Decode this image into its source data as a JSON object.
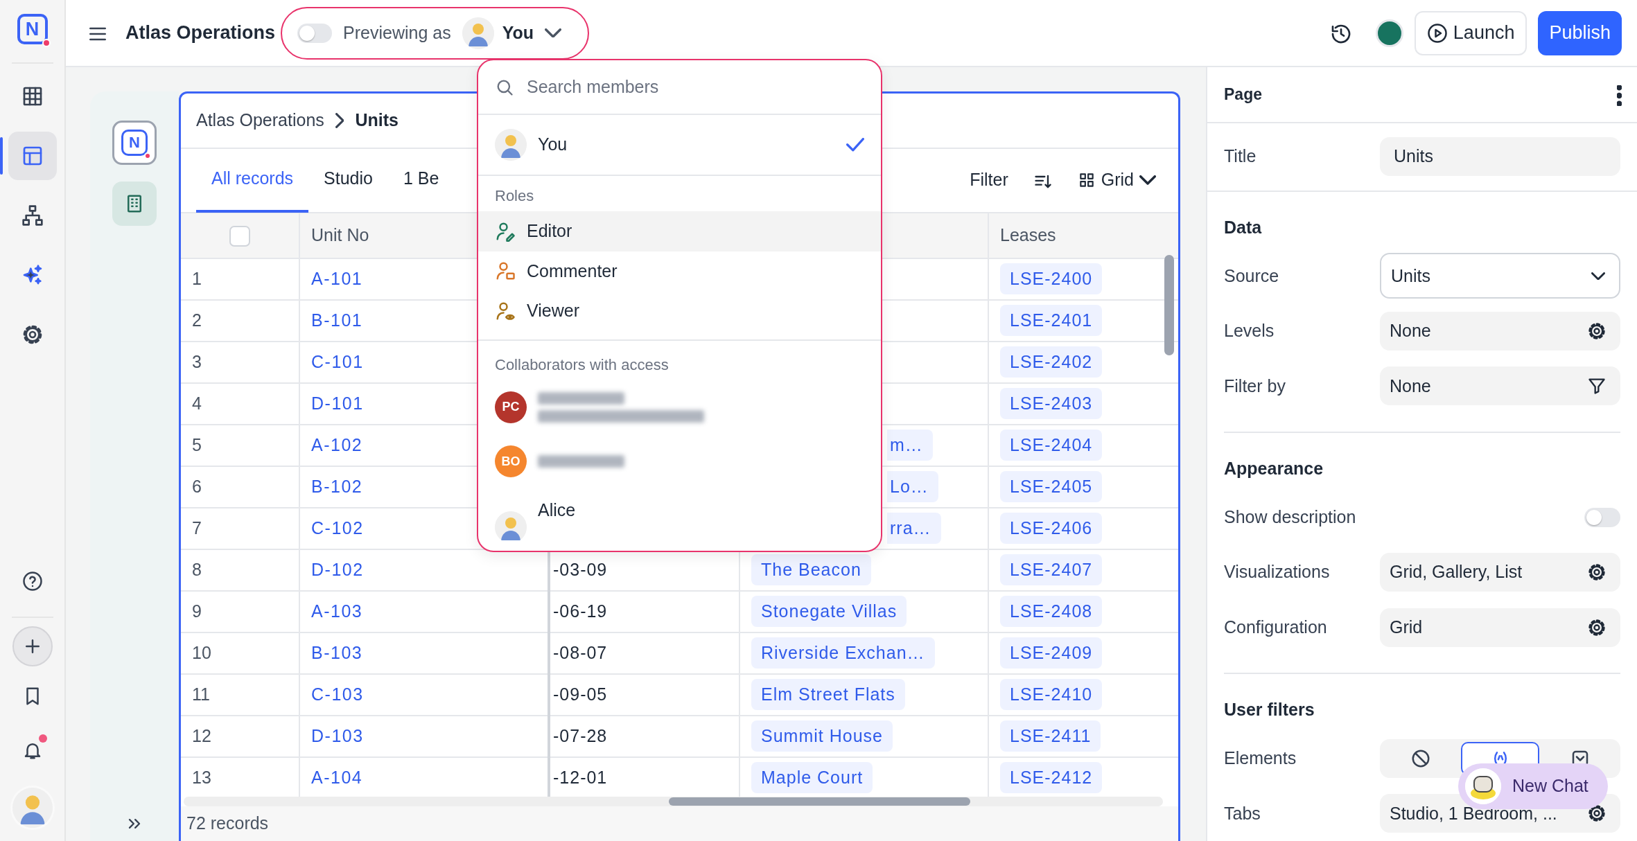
{
  "rail": {
    "logo_letter": "N",
    "items": [
      {
        "selected": false
      },
      {
        "selected": true
      },
      {
        "selected": false
      },
      {
        "selected": false
      },
      {
        "selected": false
      }
    ],
    "bottom_items": [
      {
        "notification": false
      },
      {
        "notification": false
      },
      {
        "notification": false
      },
      {
        "notification": true
      }
    ]
  },
  "topbar": {
    "title": "Atlas Operations",
    "preview": {
      "on": false,
      "label": "Previewing as",
      "user": "You"
    },
    "launch": "Launch",
    "publish": "Publish"
  },
  "members_menu": {
    "placeholder": "Search members",
    "you": {
      "name": "You",
      "selected": true
    },
    "roles_heading": "Roles",
    "roles": [
      {
        "name": "Editor",
        "color": "#1f7a5c",
        "hovered": true,
        "kind": "edit"
      },
      {
        "name": "Commenter",
        "color": "#d9772b",
        "hovered": false,
        "kind": "comment"
      },
      {
        "name": "Viewer",
        "color": "#a8741a",
        "hovered": false,
        "kind": "view"
      }
    ],
    "collaborators_heading": "Collaborators with access",
    "collaborators": [
      {
        "kind": "initials_email",
        "initials": "PC",
        "color": "#b4352c"
      },
      {
        "kind": "initials",
        "initials": "BO",
        "color": "#f5862e"
      },
      {
        "kind": "person",
        "name": "Alice"
      }
    ]
  },
  "sub_sidebar": {
    "logo_letter": "N"
  },
  "breadcrumb": [
    "Atlas Operations",
    "Units"
  ],
  "tabs": [
    {
      "label": "All records",
      "selected": true
    },
    {
      "label": "Studio",
      "selected": false
    },
    {
      "label": "1 Be",
      "selected": false
    }
  ],
  "view_controls": {
    "filter": "Filter",
    "view": "Grid"
  },
  "table": {
    "select_all": {
      "checked": false
    },
    "columns": {
      "column_2": "Unit No",
      "column_5": "Leases"
    },
    "rows": [
      {
        "number": "1",
        "unit": "A-101",
        "lease": "LSE-2400"
      },
      {
        "number": "2",
        "unit": "B-101",
        "lease": "LSE-2401"
      },
      {
        "number": "3",
        "unit": "C-101",
        "lease": "LSE-2402"
      },
      {
        "number": "4",
        "unit": "D-101",
        "lease": "LSE-2403"
      },
      {
        "number": "5",
        "unit": "A-102",
        "property": "m…",
        "covered": true,
        "lease": "LSE-2404"
      },
      {
        "number": "6",
        "unit": "B-102",
        "property": "Lo…",
        "covered": true,
        "lease": "LSE-2405"
      },
      {
        "number": "7",
        "unit": "C-102",
        "property": "rra…",
        "covered": true,
        "lease": "LSE-2406"
      },
      {
        "number": "8",
        "unit": "D-102",
        "date": "-03-09",
        "property": "The Beacon",
        "lease": "LSE-2407"
      },
      {
        "number": "9",
        "unit": "A-103",
        "date": "-06-19",
        "property": "Stonegate Villas",
        "lease": "LSE-2408"
      },
      {
        "number": "10",
        "unit": "B-103",
        "date": "-08-07",
        "property": "Riverside Exchan…",
        "lease": "LSE-2409"
      },
      {
        "number": "11",
        "unit": "C-103",
        "date": "-09-05",
        "property": "Elm Street Flats",
        "lease": "LSE-2410"
      },
      {
        "number": "12",
        "unit": "D-103",
        "date": "-07-28",
        "property": "Summit House",
        "lease": "LSE-2411"
      },
      {
        "number": "13",
        "unit": "A-104",
        "date": "-12-01",
        "property": "Maple Court",
        "lease": "LSE-2412"
      }
    ],
    "footer": "72 records"
  },
  "panel": {
    "title": "Page",
    "title_field": {
      "label": "Title",
      "value": "Units"
    },
    "sections": [
      {
        "heading": "Data",
        "fields": [
          {
            "label": "Source",
            "value": "Units",
            "kind": "select"
          },
          {
            "label": "Levels",
            "value": "None",
            "kind": "gear"
          },
          {
            "label": "Filter by",
            "value": "None",
            "kind": "filter"
          }
        ]
      },
      {
        "heading": "Appearance",
        "fields": [
          {
            "label": "Show description",
            "kind": "toggle",
            "on": false
          },
          {
            "label": "Visualizations",
            "value": "Grid, Gallery, List",
            "kind": "gear"
          },
          {
            "label": "Configuration",
            "value": "Grid",
            "kind": "gear"
          }
        ]
      },
      {
        "heading": "User filters",
        "fields": [
          {
            "label": "Elements",
            "kind": "segmented",
            "options": [
              {
                "selected": false
              },
              {
                "selected": true
              },
              {
                "selected": false
              }
            ]
          },
          {
            "label": "Tabs",
            "value": "Studio, 1 Bedroom, ...",
            "kind": "gear"
          }
        ]
      }
    ]
  },
  "chat": {
    "label": "New Chat"
  }
}
